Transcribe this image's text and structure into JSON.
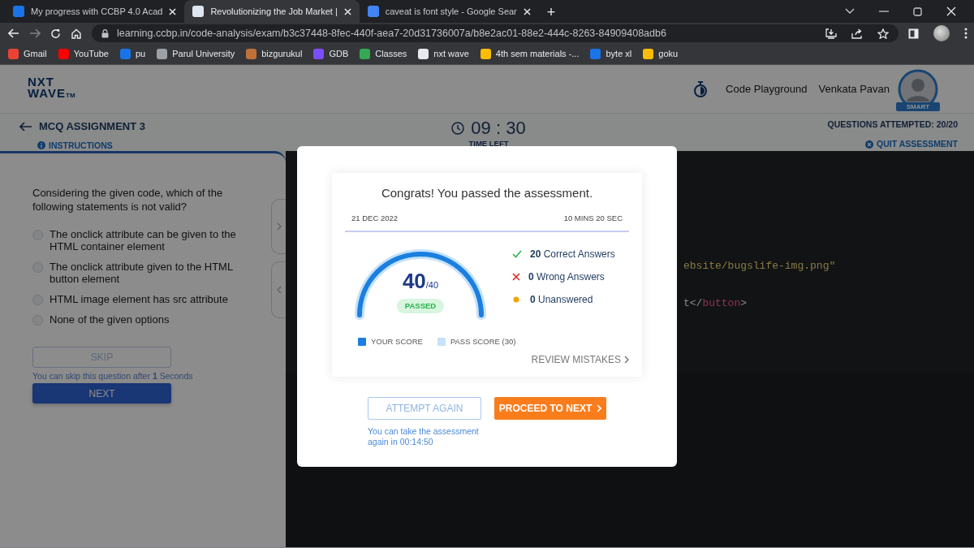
{
  "browser": {
    "tabs": [
      {
        "title": "My progress with CCBP 4.0 Acad",
        "color": "#1a73e8",
        "selected": false
      },
      {
        "title": "Revolutionizing the Job Market |",
        "color": "#dfe6f0",
        "selected": true
      },
      {
        "title": "caveat is font style - Google Sear",
        "color": "#4285f4",
        "selected": false
      }
    ],
    "new_tab": "+",
    "url": "learning.ccbp.in/code-analysis/exam/b3c37448-8fec-440f-aea7-20d31736007a/b8e2ac01-88e2-444c-8263-84909408adb6",
    "forward_disabled": true,
    "bookmarks": [
      {
        "label": "Gmail",
        "color": "#ea4335"
      },
      {
        "label": "YouTube",
        "color": "#ff0000"
      },
      {
        "label": "pu",
        "color": "#1a73e8"
      },
      {
        "label": "Parul University",
        "color": "#9aa0a6"
      },
      {
        "label": "bizgurukul",
        "color": "#c0713a"
      },
      {
        "label": "GDB",
        "color": "#7c4dff"
      },
      {
        "label": "Classes",
        "color": "#34a853"
      },
      {
        "label": "nxt wave",
        "color": "#e8eaed"
      },
      {
        "label": "4th sem materials -...",
        "color": "#fbbc04"
      },
      {
        "label": "byte xl",
        "color": "#1a73e8"
      },
      {
        "label": "goku",
        "color": "#fbbc04"
      }
    ]
  },
  "header": {
    "logo": {
      "line_1": "NXT",
      "line_2": "WAVE",
      "mark": "TM"
    },
    "code_playground": "Code Playground",
    "user_name": "Venkata Pavan",
    "badge": "SMART"
  },
  "assessment_bar": {
    "title": "MCQ ASSIGNMENT 3",
    "instructions": "INSTRUCTIONS",
    "timer": "09 : 30",
    "timer_label": "TIME LEFT",
    "attempted": "QUESTIONS ATTEMPTED: 20/20",
    "quit": "QUIT ASSESSMENT"
  },
  "question": {
    "text": "Considering the given code, which of the following statements is not valid?",
    "options": [
      {
        "label": "The onclick attribute can be given to the HTML container element",
        "selected": false
      },
      {
        "label": "The onclick attribute given to the HTML button element",
        "selected": false
      },
      {
        "label": "HTML image element has src attribute",
        "selected": false
      },
      {
        "label": "None of the given options",
        "selected": false
      }
    ],
    "skip": {
      "label": "SKIP",
      "disabled": true
    },
    "skip_note": "You can skip this question after **1** Seconds",
    "next": "NEXT"
  },
  "code_lines": [
    {
      "parts": [
        {
          "text": "ebsite/bugslife-img.png\"",
          "kind": "string"
        }
      ]
    },
    {
      "parts": [
        {
          "text": "t</",
          "kind": "plain"
        },
        {
          "text": "button",
          "kind": "tag"
        },
        {
          "text": ">",
          "kind": "plain"
        }
      ]
    }
  ],
  "result_modal": {
    "title": "Congrats! You passed the assessment.",
    "date": "21 DEC 2022",
    "duration": "10 MINS 20 SEC",
    "score": "40",
    "total": "/40",
    "level": 1,
    "status": "PASSED",
    "passed": true,
    "stats": [
      {
        "kind": "correct",
        "text": "**20** Correct Answers"
      },
      {
        "kind": "wrong",
        "text": "**0** Wrong Answers"
      },
      {
        "kind": "unanswered",
        "text": "**0** Unanswered"
      }
    ],
    "legend": [
      {
        "label": "YOUR SCORE",
        "color": "#1a7fe0"
      },
      {
        "label": "PASS SCORE (30)",
        "color": "#c5e1fb"
      }
    ],
    "review": "REVIEW MISTAKES",
    "attempt_again": {
      "label": "ATTEMPT AGAIN",
      "disabled": true
    },
    "proceed": "PROCEED TO NEXT",
    "retake_note": "You can take the assessment again in 00:14:50"
  }
}
